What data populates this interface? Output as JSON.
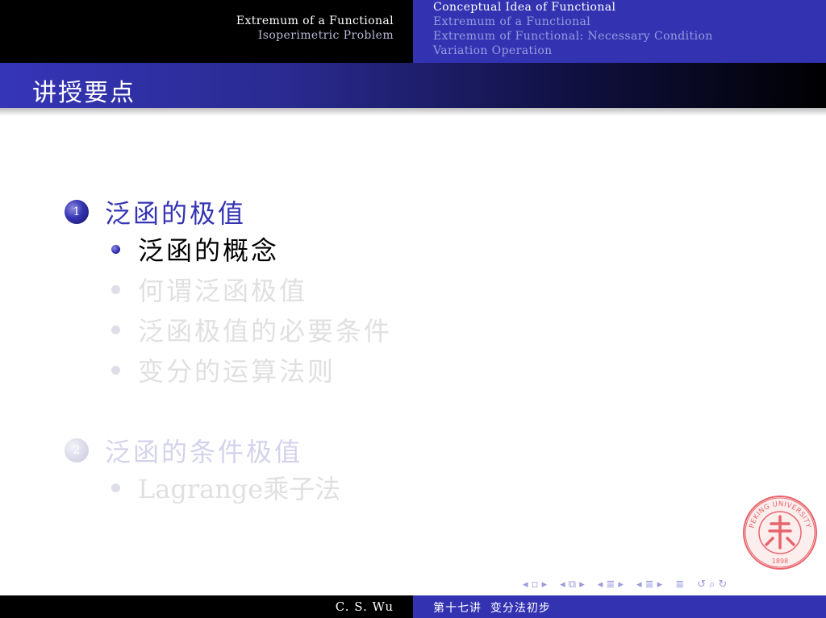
{
  "header": {
    "left": {
      "section": "Extremum of a Functional",
      "subsection": "Isoperimetric Problem"
    },
    "right": {
      "items": [
        {
          "label": "Conceptual Idea of Functional",
          "active": true
        },
        {
          "label": "Extremum of a Functional",
          "active": false
        },
        {
          "label": "Extremum of Functional: Necessary Condition",
          "active": false
        },
        {
          "label": "Variation Operation",
          "active": false
        }
      ]
    }
  },
  "frame": {
    "title": "讲授要点"
  },
  "outline": {
    "sections": [
      {
        "number": "1",
        "label": "泛函的极值",
        "active": true,
        "items": [
          {
            "label": "泛函的概念",
            "active": true
          },
          {
            "label": "何谓泛函极值",
            "active": false
          },
          {
            "label": "泛函极值的必要条件",
            "active": false
          },
          {
            "label": "变分的运算法则",
            "active": false
          }
        ]
      },
      {
        "number": "2",
        "label": "泛函的条件极值",
        "active": false,
        "items": [
          {
            "label": "Lagrange乘子法",
            "active": false
          }
        ]
      }
    ]
  },
  "seal": {
    "arc_text": "PEKING UNIVERSITY",
    "year": "1898",
    "color": "#e8646c"
  },
  "nav": {
    "symbols": [
      "◂ ▫ ▸",
      "◂ ⧉ ▸",
      "◂ ≣ ▸",
      "◂ ≣ ▸",
      "≣",
      "↺ ⌕ ↻"
    ]
  },
  "footer": {
    "author": "C. S. Wu",
    "lecture": "第十七讲  变分法初步"
  },
  "colors": {
    "structure": "#3333b2",
    "active_text": "#3434b4",
    "dim_text": "#d3d3ec"
  }
}
